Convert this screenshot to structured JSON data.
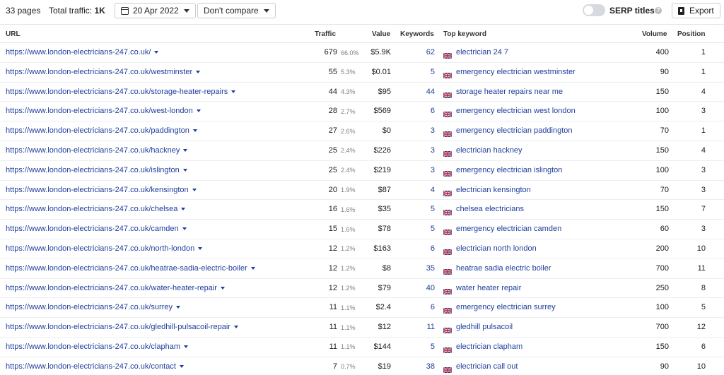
{
  "toolbar": {
    "pages_count": "33 pages",
    "total_traffic_label": "Total traffic:",
    "total_traffic_value": "1K",
    "date": "20 Apr 2022",
    "compare": "Don't compare",
    "serp_titles": "SERP titles",
    "help": "?",
    "export": "Export"
  },
  "columns": {
    "url": "URL",
    "traffic": "Traffic",
    "value": "Value",
    "keywords": "Keywords",
    "top_keyword": "Top keyword",
    "volume": "Volume",
    "position": "Position"
  },
  "colors": {
    "link": "#1f3f9c",
    "muted": "#7a7f85"
  },
  "rows": [
    {
      "url": "https://www.london-electricians-247.co.uk/",
      "traffic": "679",
      "pct": "66.0%",
      "value": "$5.9K",
      "keywords": "62",
      "top_keyword": "electrician 24 7",
      "volume": "400",
      "position": "1"
    },
    {
      "url": "https://www.london-electricians-247.co.uk/westminster",
      "traffic": "55",
      "pct": "5.3%",
      "value": "$0.01",
      "keywords": "5",
      "top_keyword": "emergency electrician westminster",
      "volume": "90",
      "position": "1"
    },
    {
      "url": "https://www.london-electricians-247.co.uk/storage-heater-repairs",
      "traffic": "44",
      "pct": "4.3%",
      "value": "$95",
      "keywords": "44",
      "top_keyword": "storage heater repairs near me",
      "volume": "150",
      "position": "4"
    },
    {
      "url": "https://www.london-electricians-247.co.uk/west-london",
      "traffic": "28",
      "pct": "2.7%",
      "value": "$569",
      "keywords": "6",
      "top_keyword": "emergency electrician west london",
      "volume": "100",
      "position": "3"
    },
    {
      "url": "https://www.london-electricians-247.co.uk/paddington",
      "traffic": "27",
      "pct": "2.6%",
      "value": "$0",
      "keywords": "3",
      "top_keyword": "emergency electrician paddington",
      "volume": "70",
      "position": "1"
    },
    {
      "url": "https://www.london-electricians-247.co.uk/hackney",
      "traffic": "25",
      "pct": "2.4%",
      "value": "$226",
      "keywords": "3",
      "top_keyword": "electrician hackney",
      "volume": "150",
      "position": "4"
    },
    {
      "url": "https://www.london-electricians-247.co.uk/islington",
      "traffic": "25",
      "pct": "2.4%",
      "value": "$219",
      "keywords": "3",
      "top_keyword": "emergency electrician islington",
      "volume": "100",
      "position": "3"
    },
    {
      "url": "https://www.london-electricians-247.co.uk/kensington",
      "traffic": "20",
      "pct": "1.9%",
      "value": "$87",
      "keywords": "4",
      "top_keyword": "electrician kensington",
      "volume": "70",
      "position": "3"
    },
    {
      "url": "https://www.london-electricians-247.co.uk/chelsea",
      "traffic": "16",
      "pct": "1.6%",
      "value": "$35",
      "keywords": "5",
      "top_keyword": "chelsea electricians",
      "volume": "150",
      "position": "7"
    },
    {
      "url": "https://www.london-electricians-247.co.uk/camden",
      "traffic": "15",
      "pct": "1.6%",
      "value": "$78",
      "keywords": "5",
      "top_keyword": "emergency electrician camden",
      "volume": "60",
      "position": "3"
    },
    {
      "url": "https://www.london-electricians-247.co.uk/north-london",
      "traffic": "12",
      "pct": "1.2%",
      "value": "$163",
      "keywords": "6",
      "top_keyword": "electrician north london",
      "volume": "200",
      "position": "10"
    },
    {
      "url": "https://www.london-electricians-247.co.uk/heatrae-sadia-electric-boiler",
      "traffic": "12",
      "pct": "1.2%",
      "value": "$8",
      "keywords": "35",
      "top_keyword": "heatrae sadia electric boiler",
      "volume": "700",
      "position": "11"
    },
    {
      "url": "https://www.london-electricians-247.co.uk/water-heater-repair",
      "traffic": "12",
      "pct": "1.2%",
      "value": "$79",
      "keywords": "40",
      "top_keyword": "water heater repair",
      "volume": "250",
      "position": "8"
    },
    {
      "url": "https://www.london-electricians-247.co.uk/surrey",
      "traffic": "11",
      "pct": "1.1%",
      "value": "$2.4",
      "keywords": "6",
      "top_keyword": "emergency electrician surrey",
      "volume": "100",
      "position": "5"
    },
    {
      "url": "https://www.london-electricians-247.co.uk/gledhill-pulsacoil-repair",
      "traffic": "11",
      "pct": "1.1%",
      "value": "$12",
      "keywords": "11",
      "top_keyword": "gledhill pulsacoil",
      "volume": "700",
      "position": "12"
    },
    {
      "url": "https://www.london-electricians-247.co.uk/clapham",
      "traffic": "11",
      "pct": "1.1%",
      "value": "$144",
      "keywords": "5",
      "top_keyword": "electrician clapham",
      "volume": "150",
      "position": "6"
    },
    {
      "url": "https://www.london-electricians-247.co.uk/contact",
      "traffic": "7",
      "pct": "0.7%",
      "value": "$19",
      "keywords": "38",
      "top_keyword": "electrician call out",
      "volume": "90",
      "position": "10"
    }
  ]
}
